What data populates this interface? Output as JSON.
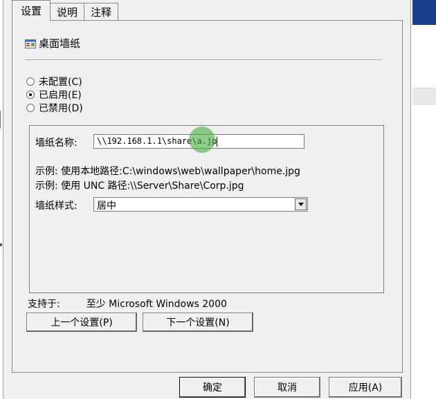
{
  "tabs": [
    {
      "label": "设置",
      "active": true
    },
    {
      "label": "说明",
      "active": false
    },
    {
      "label": "注释",
      "active": false
    }
  ],
  "policy": {
    "title": "桌面墙纸",
    "icon": "policy-setting-icon"
  },
  "state_options": [
    {
      "label": "未配置(C)",
      "checked": false
    },
    {
      "label": "已启用(E)",
      "checked": true
    },
    {
      "label": "已禁用(D)",
      "checked": false
    }
  ],
  "options": {
    "name_label": "墙纸名称:",
    "name_value": "\\\\192.168.1.1\\share\\a.jp",
    "example1": "示例: 使用本地路径:C:\\windows\\web\\wallpaper\\home.jpg",
    "example2": "示例: 使用 UNC 路径:\\\\Server\\Share\\Corp.jpg",
    "style_label": "墙纸样式:",
    "style_value": "居中"
  },
  "support": {
    "label": "支持于:",
    "value": "至少 Microsoft Windows 2000"
  },
  "nav": {
    "prev": "上一个设置(P)",
    "next": "下一个设置(N)"
  },
  "buttons": {
    "ok": "确定",
    "cancel": "取消",
    "apply": "应用(A)"
  },
  "colors": {
    "dialog_bg": "#f0f0f0",
    "titlebar_blue": "#1a3e87",
    "click_indicator": "#46aa3c"
  }
}
